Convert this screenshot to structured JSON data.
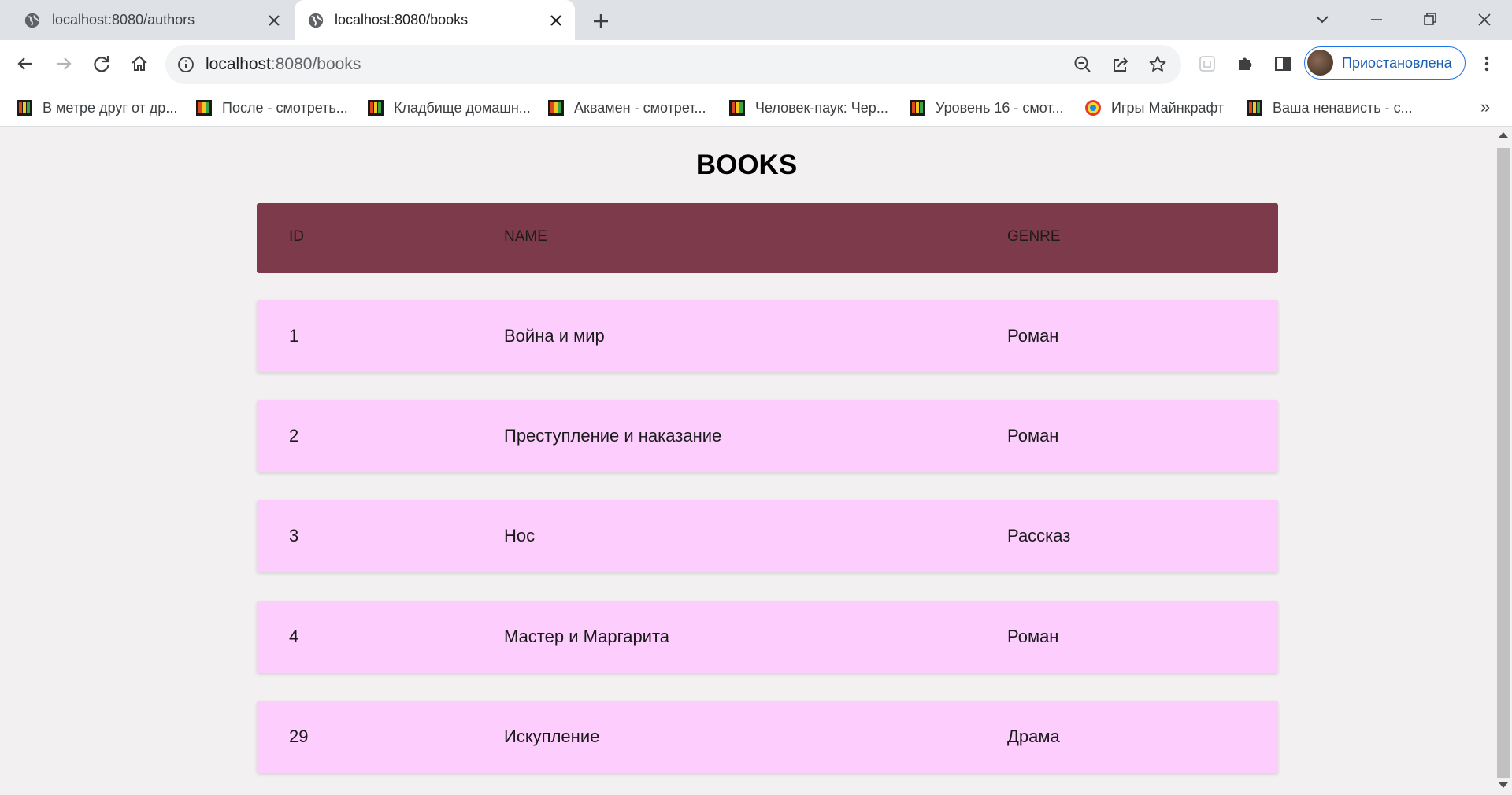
{
  "tabs": [
    {
      "title": "localhost:8080/authors",
      "active": false
    },
    {
      "title": "localhost:8080/books",
      "active": true
    }
  ],
  "omnibox": {
    "host": "localhost",
    "rest": ":8080/books"
  },
  "profile": {
    "label": "Приостановлена"
  },
  "bookmarks": [
    {
      "label": "В метре друг от др...",
      "icon": "film-site-icon"
    },
    {
      "label": "После - смотреть...",
      "icon": "film-site-icon"
    },
    {
      "label": "Кладбище домашн...",
      "icon": "film-site-icon"
    },
    {
      "label": "Аквамен - смотрет...",
      "icon": "film-site-icon"
    },
    {
      "label": "Человек-паук: Чер...",
      "icon": "film-site-icon"
    },
    {
      "label": "Уровень 16 - смот...",
      "icon": "film-site-icon"
    },
    {
      "label": "Игры Майнкрафт",
      "icon": "games-site-icon"
    },
    {
      "label": "Ваша ненависть - с...",
      "icon": "film-site-icon"
    }
  ],
  "bookmarks_more": "»",
  "page": {
    "title": "BOOKS",
    "table": {
      "headers": {
        "id": "ID",
        "name": "NAME",
        "genre": "GENRE"
      },
      "header_color": "#7d3a4b",
      "row_color": "#fccdfd",
      "rows": [
        {
          "id": "1",
          "name": "Война и мир",
          "genre": "Роман"
        },
        {
          "id": "2",
          "name": "Преступление и наказание",
          "genre": "Роман"
        },
        {
          "id": "3",
          "name": "Нос",
          "genre": "Рассказ"
        },
        {
          "id": "4",
          "name": "Мастер и Маргарита",
          "genre": "Роман"
        },
        {
          "id": "29",
          "name": "Искупление",
          "genre": "Драма"
        }
      ]
    }
  }
}
